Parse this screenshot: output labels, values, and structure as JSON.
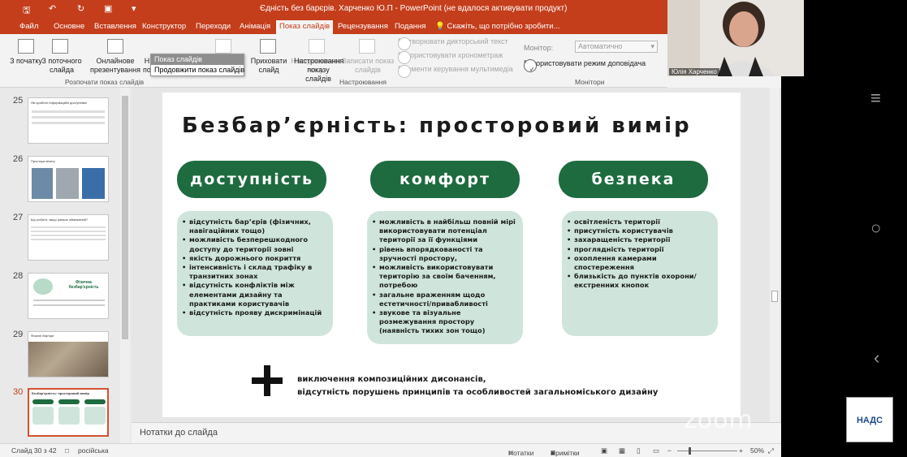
{
  "window": {
    "title": "Єдність без барєрів. Харченко Ю.П - PowerPoint (не вдалося активувати продукт)"
  },
  "tabs": [
    {
      "label": "Файл"
    },
    {
      "label": "Основне"
    },
    {
      "label": "Вставлення"
    },
    {
      "label": "Конструктор"
    },
    {
      "label": "Переходи"
    },
    {
      "label": "Анімація"
    },
    {
      "label": "Показ слайдів"
    },
    {
      "label": "Рецензування"
    },
    {
      "label": "Подання"
    },
    {
      "label": "Скажіть, що потрібно зробити..."
    }
  ],
  "ribbon": {
    "from_start": "З початку",
    "from_current": "З поточного слайда",
    "online": "Онлайнове презентування",
    "custom_cut": "Н по",
    "group_start": "Розпочати показ слайдів",
    "setup_show": "Настроювання показу слайдів",
    "hide_slide": "Приховати слайд",
    "rehearse": "Настроювання часу",
    "record": "Записати показ слайдів",
    "play_narration": "Відтворювати дикторський текст",
    "use_timings": "Використовувати хронометраж",
    "media_controls": "Елементи керування мультимедіа",
    "group_setup": "Настроювання",
    "monitor_label": "Монітор:",
    "monitor_value": "Автоматично",
    "presenter_view": "Використовувати режим доповідача",
    "group_monitors": "Монітори"
  },
  "dropdown": {
    "items": [
      "Показ слайдів",
      "Продовжити показ слайдів"
    ]
  },
  "thumbnails": [
    {
      "num": "25",
      "title": "Які зробити інформаційні доступніми"
    },
    {
      "num": "26",
      "title": "Простори візиту"
    },
    {
      "num": "27",
      "title": "Що робити, якщо раніше обмежений?"
    },
    {
      "num": "28",
      "title": "Фізична безбар'єрність"
    },
    {
      "num": "29",
      "title": "Фізичні бар'єри"
    },
    {
      "num": "30",
      "title": "Безбар'єрність: просторовий вимір"
    }
  ],
  "slide": {
    "title": "Безбар’єрність: просторовий вимір",
    "columns": [
      {
        "heading": "доступність",
        "items": [
          "відсутність бар’єрів (фізичних, навігаційних тощо)",
          "можливість безперешкодного доступу до території зовні",
          "якість дорожнього покриття",
          "інтенсивність і склад трафіку в транзитних зонах",
          "відсутність конфліктів між елементами дизайну та практиками користувачів",
          "відсутність прояву дискримінацій"
        ]
      },
      {
        "heading": "комфорт",
        "items": [
          "можливість в найбільш повній мірі використовувати потенціал території за її функціями",
          "рівень впорядкованості та зручності простору,",
          "можливість використовувати територію за своїм баченням, потребою",
          "загальне враженням щодо естетичності/привабливості",
          "звукове та візуальне розмежування простору (наявність тихих зон тощо)"
        ]
      },
      {
        "heading": "безпека",
        "items": [
          "освітленість території",
          "присутність користувачів",
          "захаращеність території",
          "проглядність території",
          "охоплення камерами спостереження",
          "близькість до пунктів охорони/ екстренних кнопок"
        ]
      }
    ],
    "footer_line1": "виключення композиційних дисонансів,",
    "footer_line2": "відсутність порушень принципів та особливостей загальноміського дизайну"
  },
  "notes_placeholder": "Нотатки до слайда",
  "status": {
    "slide_count": "Слайд 30 з 42",
    "language": "російська",
    "notes": "Нотатки",
    "comments": "Примітки",
    "zoom": "50%"
  },
  "zoom_overlay": {
    "participant_name": "Юлія Харченко",
    "watermark": "zoom",
    "logo_text": "НАДС"
  },
  "colors": {
    "ppt_accent": "#c43e1c",
    "pill_green": "#1e6b40",
    "box_mint": "#cfe5dc"
  }
}
